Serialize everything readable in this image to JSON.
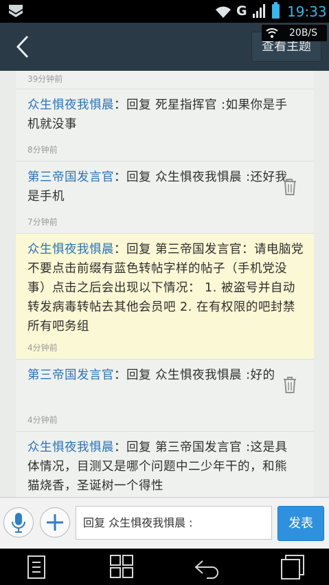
{
  "status_bar": {
    "network": "G",
    "time": "19:33",
    "icons": [
      "app-notification-icon",
      "wifi-icon",
      "signal-bars-icon",
      "battery-icon"
    ]
  },
  "header": {
    "back_icon": "chevron-left-icon",
    "view_topic_label": "查看主题",
    "speed": "20B/S"
  },
  "comments": [
    {
      "author": "",
      "text": "",
      "time": "39分钟前",
      "deletable": false
    },
    {
      "author": "众生惧夜我惧晨",
      "text": "：回复 死星指挥官 :如果你是手机就没事",
      "time": "8分钟前",
      "deletable": false
    },
    {
      "author": "第三帝国发言官",
      "text": "：回复 众生惧夜我惧晨 :还好我是手机",
      "time": "7分钟前",
      "deletable": true
    },
    {
      "author": "众生惧夜我惧晨",
      "text": "：回复 第三帝国发言官：请电脑党不要点击前缀有蓝色转帖字样的帖子（手机党没事）点击之后会出现以下情况： 1. 被盗号并自动转发病毒转帖去其他会员吧 2. 在有权限的吧封禁所有吧务组",
      "time": "4分钟前",
      "deletable": false,
      "highlighted": true
    },
    {
      "author": "第三帝国发言官",
      "text": "：回复 众生惧夜我惧晨 :好的",
      "time": "4分钟前",
      "deletable": true
    },
    {
      "author": "众生惧夜我惧晨",
      "text": "：回复 第三帝国发言官 :这是具体情况，目测又是哪个问题中二少年干的，和熊猫烧香，圣诞树一个得性",
      "time": "",
      "deletable": false
    }
  ],
  "reply_bar": {
    "mic_icon": "microphone-icon",
    "plus_icon": "plus-icon",
    "input_value": "回复 众生惧夜我惧晨 :",
    "send_label": "发表"
  },
  "nav_bar": {
    "icons": [
      "menu-icon",
      "home-icon",
      "back-icon",
      "recent-apps-icon"
    ]
  },
  "colors": {
    "header_bg": "#2a3a47",
    "author_blue": "#2b73b7",
    "highlight_bg": "#fbf8d5",
    "send_blue": "#2f91dd",
    "status_blue": "#3bb6e8"
  }
}
